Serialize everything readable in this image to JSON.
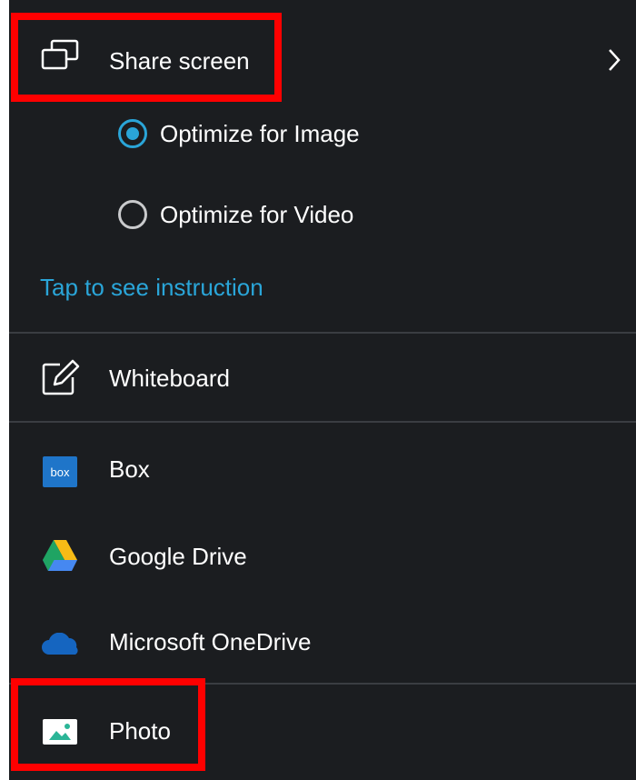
{
  "share_screen": {
    "label": "Share screen"
  },
  "optimize_options": [
    {
      "label": "Optimize for Image",
      "selected": true
    },
    {
      "label": "Optimize for Video",
      "selected": false
    }
  ],
  "instruction_link": "Tap to see instruction",
  "whiteboard": {
    "label": "Whiteboard"
  },
  "cloud_sources": [
    {
      "label": "Box",
      "icon": "box-logo-icon",
      "badge": "box"
    },
    {
      "label": "Google Drive",
      "icon": "google-drive-icon"
    },
    {
      "label": "Microsoft OneDrive",
      "icon": "onedrive-icon"
    }
  ],
  "photo": {
    "label": "Photo",
    "icon": "photo-icon"
  },
  "colors": {
    "panel_bg": "#1b1d20",
    "accent": "#2aa5d8",
    "highlight": "#ff0000",
    "text": "#ffffff"
  }
}
